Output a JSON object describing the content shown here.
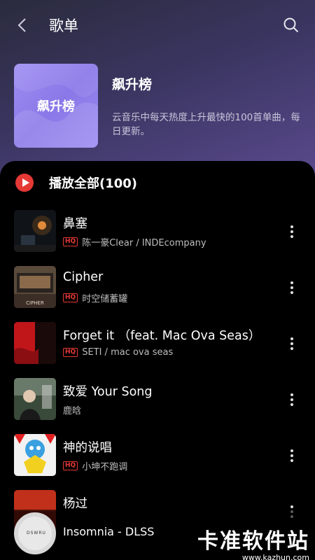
{
  "header": {
    "title": "歌单"
  },
  "playlist": {
    "cover_text": "飙升榜",
    "name": "飙升榜",
    "description": "云音乐中每天热度上升最快的100首单曲，每日更新。"
  },
  "play_all": {
    "label": "播放全部(100)"
  },
  "songs": [
    {
      "title": "鼻塞",
      "artist": "陈一豪Clear / INDEcompany",
      "hq": "HQ"
    },
    {
      "title": "Cipher",
      "artist": "时空储蓄罐",
      "hq": "HQ",
      "thumb_text": "CIPHER"
    },
    {
      "title": "Forget it （feat. Mac Ova Seas）",
      "artist": "SETI / mac ova seas",
      "hq": "HQ"
    },
    {
      "title": "致爱 Your Song",
      "artist": "鹿晗",
      "hq": ""
    },
    {
      "title": "神的说唱",
      "artist": "小坤不跑调",
      "hq": "HQ"
    },
    {
      "title": "杨过",
      "artist": "",
      "hq": ""
    }
  ],
  "mini_player": {
    "title": "Insomnia - DLSS",
    "disc_text": "DSWRU"
  },
  "watermark": {
    "main": "卡准软件站",
    "sub": "www.kazhun.com"
  },
  "colors": {
    "accent": "#e53935",
    "header_gradient_end": "#5a4a8e",
    "cover": "#9f8ef2"
  }
}
